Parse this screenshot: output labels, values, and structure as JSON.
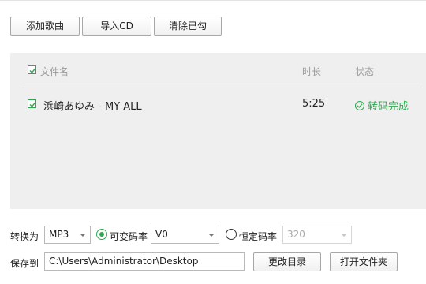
{
  "toolbar": {
    "add_song": "添加歌曲",
    "import_cd": "导入CD",
    "clear_checked": "清除已勾"
  },
  "list": {
    "columns": {
      "filename": "文件名",
      "duration": "时长",
      "status": "状态"
    },
    "select_all_checked": true,
    "rows": [
      {
        "checked": true,
        "filename": "浜崎あゆみ - MY ALL",
        "duration": "5:25",
        "status": "转码完成",
        "status_icon": "check-circle-icon"
      }
    ]
  },
  "options": {
    "convert_label": "转换为",
    "format": "MP3",
    "vbr_label": "可变码率",
    "vbr_selected": true,
    "vbr_value": "V0",
    "cbr_label": "恒定码率",
    "cbr_selected": false,
    "cbr_value": "320",
    "save_label": "保存到",
    "save_path": "C:\\Users\\Administrator\\Desktop",
    "change_dir": "更改目录",
    "open_folder": "打开文件夹"
  },
  "colors": {
    "accent": "#2fa84f",
    "list_bg": "#efefef",
    "header_text": "#9a9a9a"
  }
}
